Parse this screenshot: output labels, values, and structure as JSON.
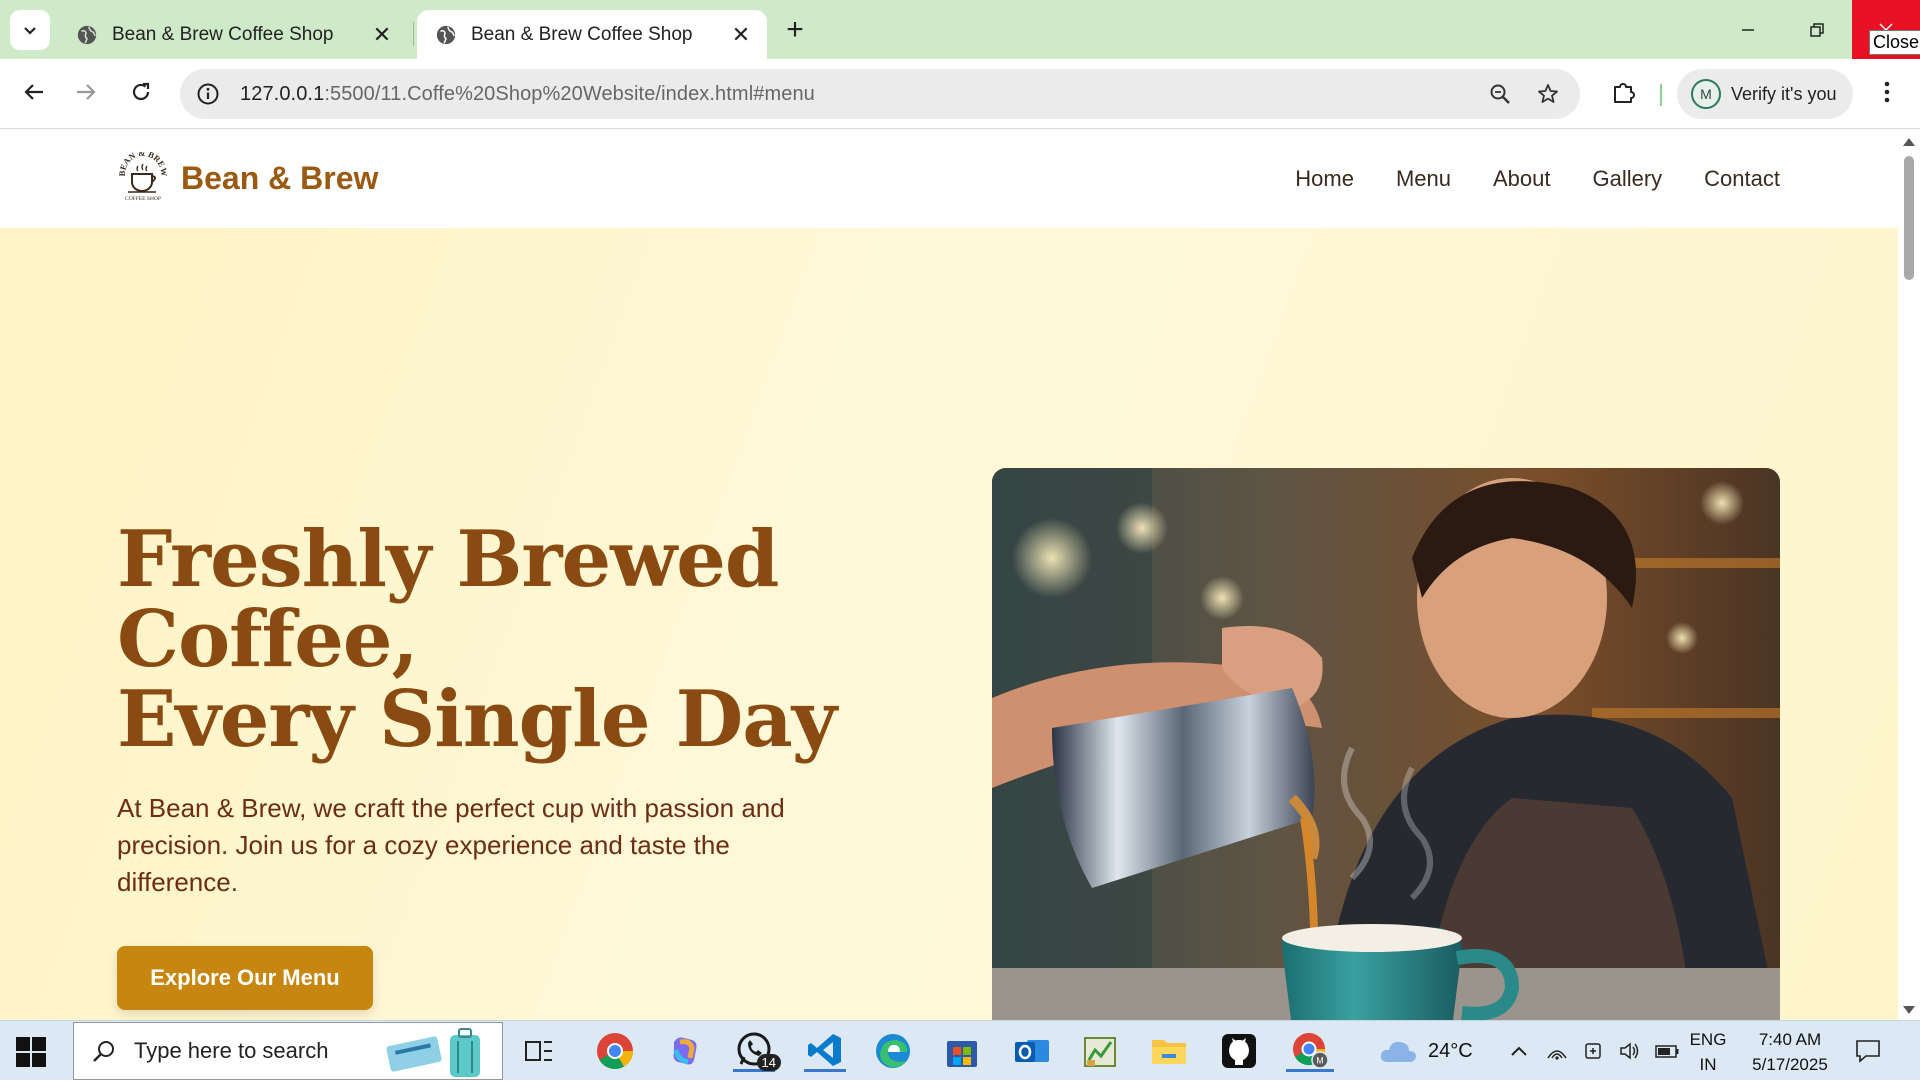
{
  "browser": {
    "tabs": [
      {
        "title": "Bean & Brew Coffee Shop",
        "active": false
      },
      {
        "title": "Bean & Brew Coffee Shop",
        "active": true
      }
    ],
    "close_tooltip": "Close",
    "url_host": "127.0.0.1",
    "url_rest": ":5500/11.Coffe%20Shop%20Website/index.html#menu",
    "profile_initial": "M",
    "profile_label": "Verify it's you"
  },
  "site": {
    "brand": "Bean & Brew",
    "logo_text_top": "BEAN & BREW",
    "logo_text_bottom": "COFFEE SHOP",
    "nav": [
      "Home",
      "Menu",
      "About",
      "Gallery",
      "Contact"
    ],
    "hero": {
      "title_lines": [
        "Freshly Brewed",
        "Coffee,",
        "Every Single Day"
      ],
      "text": "At Bean & Brew, we craft the perfect cup with passion and precision. Join us for a cozy experience and taste the difference.",
      "cta": "Explore Our Menu"
    }
  },
  "taskbar": {
    "search_placeholder": "Type here to search",
    "whatsapp_badge": "14",
    "weather": "24°C",
    "lang_top": "ENG",
    "lang_bottom": "IN",
    "time": "7:40 AM",
    "date": "5/17/2025"
  },
  "colors": {
    "tabstrip": "#cfeac8",
    "brand": "#9a5a12",
    "hero_title": "#8a4b12",
    "hero_text": "#6b2e14",
    "cta": "#c6860f",
    "hero_bg": "#fef6c8"
  }
}
